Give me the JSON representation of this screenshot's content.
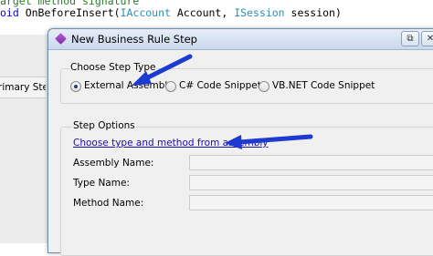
{
  "code": {
    "line1": "arget method signature",
    "line2_kw": "oid",
    "line2_method": " OnBeforeInsert(",
    "line2_type1": "IAccount",
    "line2_arg1": " Account, ",
    "line2_type2": "ISession",
    "line2_arg2": " session)"
  },
  "left_panel": {
    "tab_label": "rimary Steps"
  },
  "dialog": {
    "title": "New Business Rule Step",
    "restore_glyph": "⧉",
    "close_glyph": "✕",
    "step_type": {
      "title": "Choose Step Type",
      "options": [
        {
          "label": "External Assembly",
          "selected": true
        },
        {
          "label": "C# Code Snippet",
          "selected": false
        },
        {
          "label": "VB.NET Code Snippet",
          "selected": false
        }
      ]
    },
    "step_options": {
      "title": "Step Options",
      "link": "Choose type and method from assembly",
      "fields": [
        {
          "label": "Assembly Name:",
          "value": ""
        },
        {
          "label": "Type Name:",
          "value": ""
        },
        {
          "label": "Method Name:",
          "value": ""
        }
      ]
    }
  },
  "colors": {
    "accent_arrow": "#1e3bd1",
    "link": "#1a0dab"
  }
}
